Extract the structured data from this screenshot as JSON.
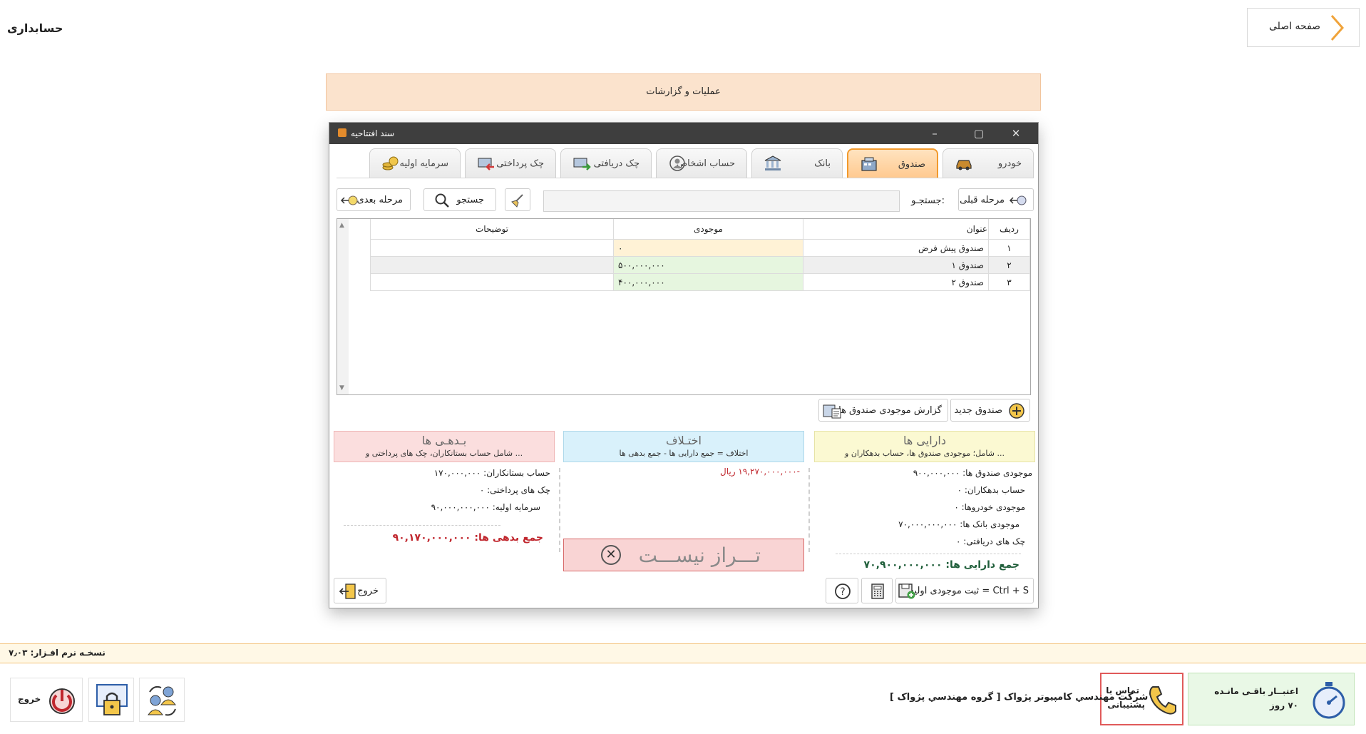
{
  "app_title": "حسابداری",
  "home_button": "صفحه اصلی",
  "ops_bar": "عملیات و گزارشات",
  "window": {
    "title": "سند افتتاحیه",
    "tabs": [
      {
        "label": "خودرو",
        "icon": "car-icon"
      },
      {
        "label": "صندوق",
        "icon": "cashbox-icon",
        "active": true
      },
      {
        "label": "بانک",
        "icon": "bank-icon"
      },
      {
        "label": "حساب اشخاص",
        "icon": "person-icon"
      },
      {
        "label": "چک دریافتی",
        "icon": "received-check-icon"
      },
      {
        "label": "چک پرداختی",
        "icon": "paid-check-icon"
      },
      {
        "label": "سرمایه اولیه",
        "icon": "coins-icon"
      }
    ],
    "prev_step": "مرحله قبلی",
    "search_label": "جستجـو:",
    "search_value": "",
    "search_button": "جستجو",
    "next_step": "مرحله بعدی",
    "grid": {
      "headers": [
        "ردیف",
        "عنوان",
        "موجودی",
        "توضیحات"
      ],
      "rows": [
        {
          "row": "۱",
          "title": "صندوق پیش فرض",
          "balance": "۰",
          "desc": ""
        },
        {
          "row": "۲",
          "title": "صندوق ۱",
          "balance": "۵۰۰,۰۰۰,۰۰۰",
          "desc": ""
        },
        {
          "row": "۳",
          "title": "صندوق ۲",
          "balance": "۴۰۰,۰۰۰,۰۰۰",
          "desc": ""
        }
      ]
    },
    "new_cashbox": "صندوق جدید",
    "cashbox_report": "گزارش موجودی صندوق ها",
    "assets": {
      "title": "دارایی ها",
      "subtitle": "شامل؛ موجودی صندوق ها، حساب بدهکاران و ...",
      "lines": [
        "موجودی صندوق ها: ۹۰۰,۰۰۰,۰۰۰",
        "حساب بدهکاران: ۰",
        "موجودی خودروها: ۰",
        "موجودی بانک ها: ۷۰,۰۰۰,۰۰۰,۰۰۰",
        "چک های دریافتی: ۰"
      ],
      "total": "جمع دارایی ها: ۷۰,۹۰۰,۰۰۰,۰۰۰"
    },
    "diff": {
      "title": "اختـلاف",
      "subtitle": "اختلاف = جمع دارایی ها - جمع بدهی ها",
      "value": "-۱۹,۲۷۰,۰۰۰,۰۰۰ ریال",
      "status": "تـــراز نیســـت"
    },
    "debts": {
      "title": "بـدهـی ها",
      "subtitle": "شامل حساب بستانکاران، چک های پرداختی و ...",
      "lines": [
        "حساب بستانکاران: ۱۷۰,۰۰۰,۰۰۰",
        "چک های پرداختی: ۰",
        "سرمایه اولیه: ۹۰,۰۰۰,۰۰۰,۰۰۰"
      ],
      "total": "جمع بدهی ها: ۹۰,۱۷۰,۰۰۰,۰۰۰"
    },
    "save_button": "ثبت موجودی اولیه = Ctrl + S",
    "exit_button": "خروج"
  },
  "version": "نسخـه نرم افـزار: ۷٫۰۳",
  "credit": {
    "line1": "اعتبــار باقـی مانـده",
    "line2": "۷۰ روز"
  },
  "support": {
    "line1": "تماس با",
    "line2": "پشتیبانی"
  },
  "company": "شرکت مهندسي کامپيوتر پژواک [ گروه مهندسي پژواک ]",
  "exit_bottom": "خروج",
  "colors": {
    "accent": "#f29a2d",
    "ops_bg": "#fbe3cd",
    "debt_total": "#c0262d",
    "asset_total": "#1f5e3a"
  }
}
